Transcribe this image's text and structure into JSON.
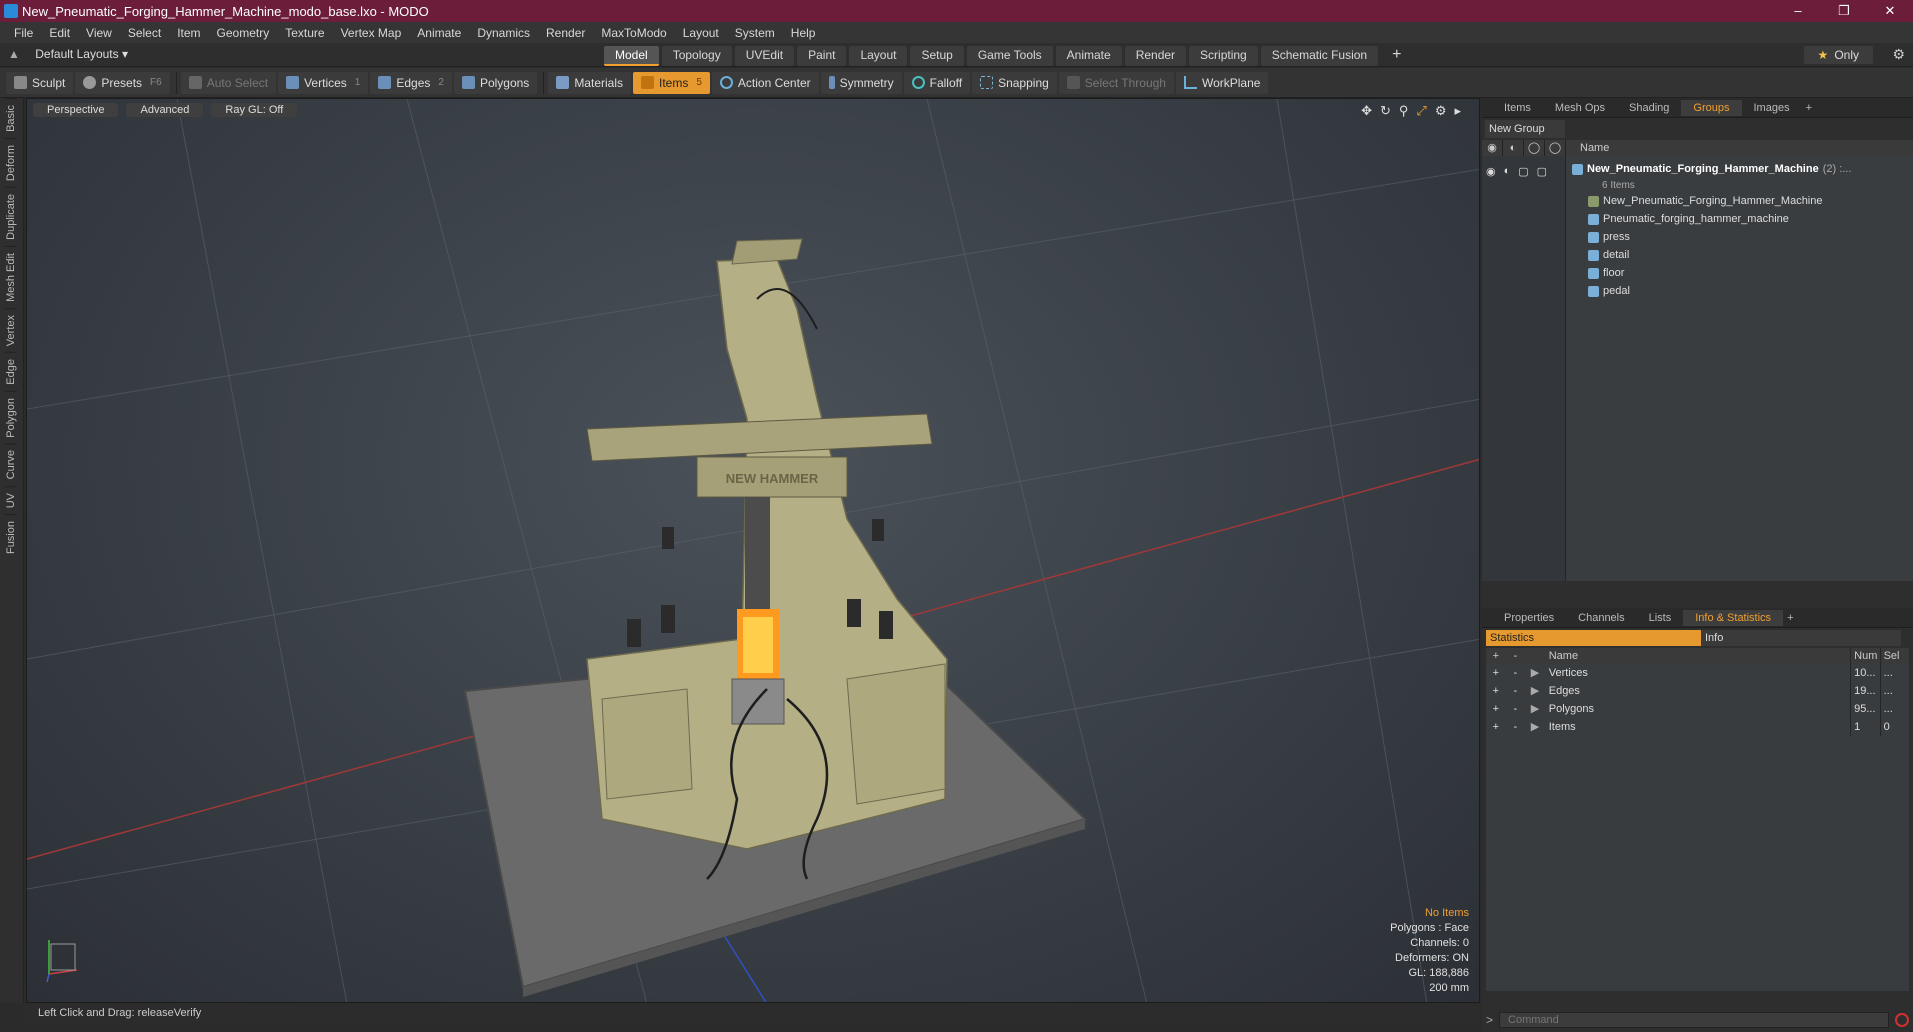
{
  "window": {
    "title": "New_Pneumatic_Forging_Hammer_Machine_modo_base.lxo - MODO",
    "minimize": "–",
    "maximize": "❐",
    "close": "✕"
  },
  "menu": [
    "File",
    "Edit",
    "View",
    "Select",
    "Item",
    "Geometry",
    "Texture",
    "Vertex Map",
    "Animate",
    "Dynamics",
    "Render",
    "MaxToModo",
    "Layout",
    "System",
    "Help"
  ],
  "layout": {
    "selector": "Default Layouts ▾",
    "tabs": [
      "Model",
      "Topology",
      "UVEdit",
      "Paint",
      "Layout",
      "Setup",
      "Game Tools",
      "Animate",
      "Render",
      "Scripting",
      "Schematic Fusion"
    ],
    "active_tab": "Model",
    "add": "+",
    "only": "Only"
  },
  "toolbar": {
    "sculpt": "Sculpt",
    "presets": "Presets",
    "presets_key": "F6",
    "auto_select": "Auto Select",
    "vertices": "Vertices",
    "vertices_key": "1",
    "edges": "Edges",
    "edges_key": "2",
    "polygons": "Polygons",
    "materials": "Materials",
    "items": "Items",
    "items_key": "5",
    "action_center": "Action Center",
    "symmetry": "Symmetry",
    "falloff": "Falloff",
    "snapping": "Snapping",
    "select_through": "Select Through",
    "workplane": "WorkPlane"
  },
  "left_tabs": [
    "Basic",
    "Deform",
    "Duplicate",
    "Mesh Edit",
    "Vertex",
    "Edge",
    "Polygon",
    "Curve",
    "UV",
    "Fusion"
  ],
  "viewport": {
    "view": "Perspective",
    "shading": "Advanced",
    "raygl": "Ray GL: Off",
    "info": {
      "items": "No Items",
      "polygons": "Polygons : Face",
      "channels": "Channels: 0",
      "deformers": "Deformers: ON",
      "gl": "GL: 188,886",
      "scale": "200 mm"
    },
    "plate": "NEW HAMMER"
  },
  "status": "Left Click and Drag:  releaseVerify",
  "groups_panel": {
    "tabs": [
      "Items",
      "Mesh Ops",
      "Shading",
      "Groups",
      "Images"
    ],
    "active": "Groups",
    "new_group": "New Group",
    "name_header": "Name",
    "root": "New_Pneumatic_Forging_Hammer_Machine",
    "root_count": "(2) :...",
    "root_sub": "6 Items",
    "children": [
      "New_Pneumatic_Forging_Hammer_Machine",
      "Pneumatic_forging_hammer_machine",
      "press",
      "detail",
      "floor",
      "pedal"
    ]
  },
  "info_panel": {
    "tabs": [
      "Properties",
      "Channels",
      "Lists",
      "Info & Statistics"
    ],
    "active": "Info & Statistics",
    "statistics": "Statistics",
    "info": "Info",
    "headers": {
      "name": "Name",
      "num": "Num",
      "sel": "Sel"
    },
    "rows": [
      {
        "name": "Vertices",
        "num": "10...",
        "sel": "..."
      },
      {
        "name": "Edges",
        "num": "19...",
        "sel": "..."
      },
      {
        "name": "Polygons",
        "num": "95...",
        "sel": "..."
      },
      {
        "name": "Items",
        "num": "1",
        "sel": "0"
      }
    ]
  },
  "command": {
    "prompt": ">",
    "placeholder": "Command"
  },
  "colors": {
    "title_bar": "#6b1d3a",
    "accent": "#e6992e",
    "viewport": "#3a4047",
    "machine": "#b8b38a"
  }
}
